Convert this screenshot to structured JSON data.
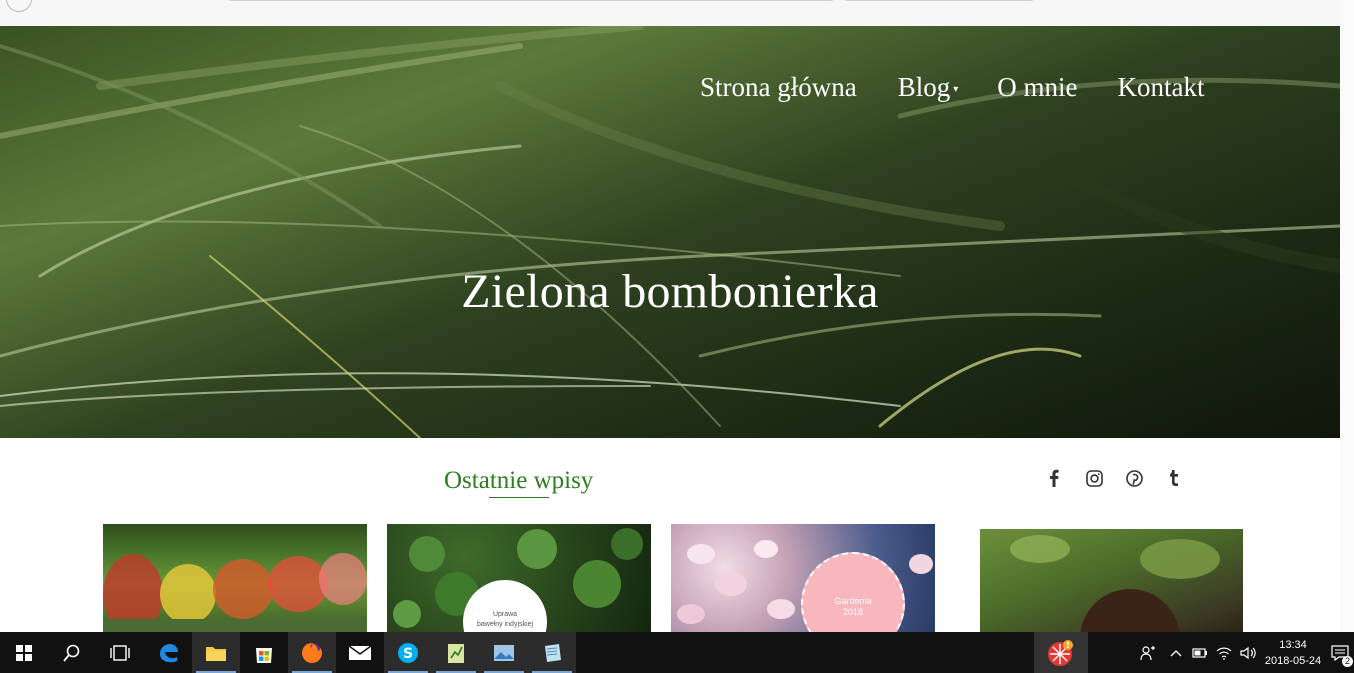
{
  "nav": {
    "items": [
      "Strona główna",
      "Blog",
      "O mnie",
      "Kontakt"
    ]
  },
  "site": {
    "title": "Zielona bombonierka"
  },
  "recent": {
    "title": "Ostatnie wpisy"
  },
  "social": [
    "facebook-icon",
    "instagram-icon",
    "pinterest-icon",
    "tumblr-icon"
  ],
  "cards": [
    {
      "badge": ""
    },
    {
      "badge_line1": "Uprawa",
      "badge_line2": "bawełny indyjskiej"
    },
    {
      "badge_line1": "Gardenia",
      "badge_line2": "2018"
    },
    {
      "badge": ""
    }
  ],
  "taskbar": {
    "apps": [
      "windows-start-icon",
      "search-icon",
      "task-view-icon",
      "edge-icon",
      "file-explorer-icon",
      "store-icon",
      "firefox-icon",
      "mail-icon",
      "skype-icon",
      "notepad-icon",
      "photos-icon",
      "app-icon"
    ],
    "time": "13:34",
    "date": "2018-05-24",
    "notification_count": "2"
  },
  "colors": {
    "accent_green": "#2e7d1f",
    "taskbar": "#111111"
  }
}
